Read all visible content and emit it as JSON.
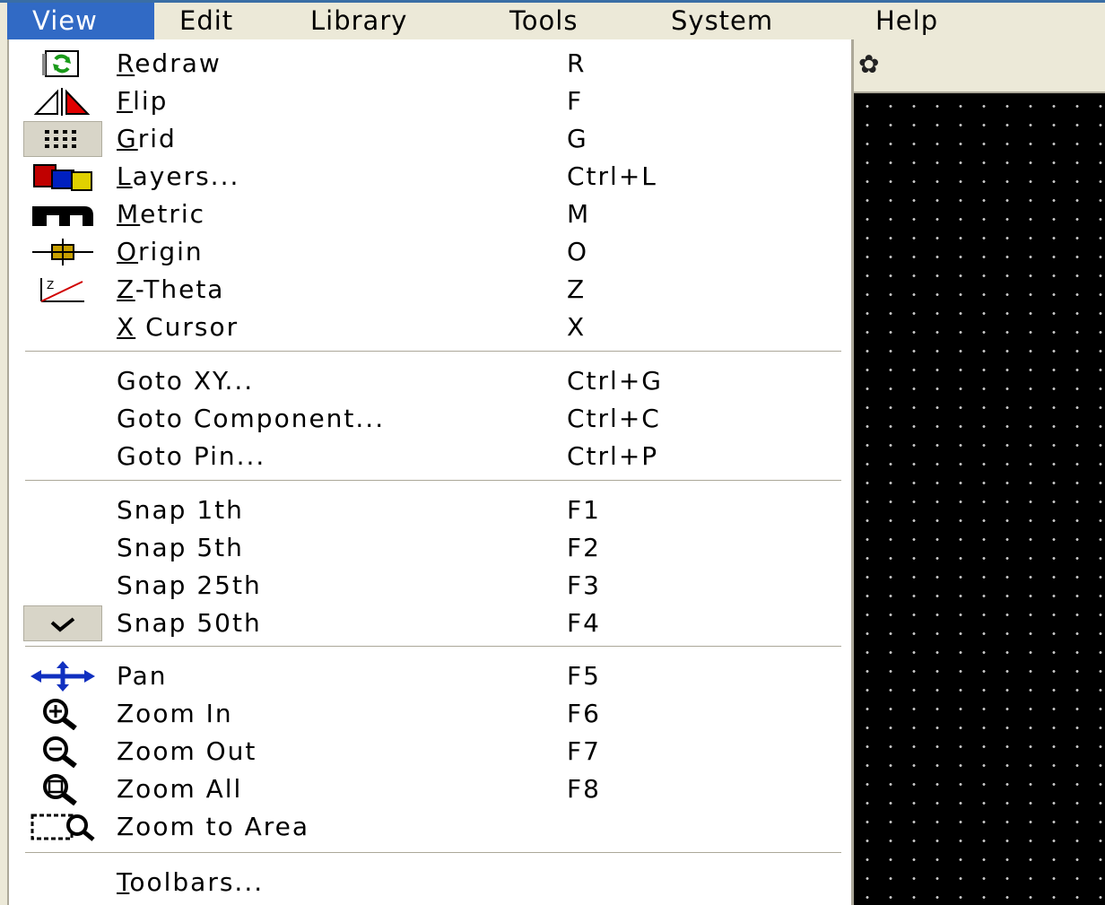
{
  "menubar": {
    "items": [
      {
        "label": "View",
        "active": true
      },
      {
        "label": "Edit"
      },
      {
        "label": "Library"
      },
      {
        "label": "Tools"
      },
      {
        "label": "System"
      },
      {
        "label": "Help"
      }
    ]
  },
  "view_menu": {
    "items": [
      {
        "label": "Redraw",
        "accel": "R",
        "shortcut": "R",
        "icon": "redraw-icon"
      },
      {
        "label": "Flip",
        "accel": "F",
        "shortcut": "F",
        "icon": "flip-icon"
      },
      {
        "label": "Grid",
        "accel": "G",
        "shortcut": "G",
        "icon": "grid-icon",
        "checked": true
      },
      {
        "label": "Layers...",
        "accel": "L",
        "shortcut": "Ctrl+L",
        "icon": "layers-icon"
      },
      {
        "label": "Metric",
        "accel": "M",
        "shortcut": "M",
        "icon": "metric-icon"
      },
      {
        "label": "Origin",
        "accel": "O",
        "shortcut": "O",
        "icon": "origin-icon"
      },
      {
        "label": "Z-Theta",
        "accel": "Z",
        "shortcut": "Z",
        "icon": "z-theta-icon"
      },
      {
        "label": "X Cursor",
        "accel": "X",
        "shortcut": "X"
      },
      {
        "label": "Goto XY...",
        "shortcut": "Ctrl+G"
      },
      {
        "label": "Goto Component...",
        "shortcut": "Ctrl+C"
      },
      {
        "label": "Goto Pin...",
        "shortcut": "Ctrl+P"
      },
      {
        "label": "Snap 1th",
        "shortcut": "F1"
      },
      {
        "label": "Snap 5th",
        "shortcut": "F2"
      },
      {
        "label": "Snap 25th",
        "shortcut": "F3"
      },
      {
        "label": "Snap 50th",
        "shortcut": "F4",
        "icon": "checkmark-icon",
        "checked": true
      },
      {
        "label": "Pan",
        "shortcut": "F5",
        "icon": "pan-icon"
      },
      {
        "label": "Zoom In",
        "shortcut": "F6",
        "icon": "zoom-in-icon"
      },
      {
        "label": "Zoom Out",
        "shortcut": "F7",
        "icon": "zoom-out-icon"
      },
      {
        "label": "Zoom All",
        "shortcut": "F8",
        "icon": "zoom-all-icon"
      },
      {
        "label": "Zoom to Area",
        "shortcut": "",
        "icon": "zoom-to-area-icon"
      },
      {
        "label": "Toolbars...",
        "accel": "T",
        "shortcut": ""
      }
    ]
  },
  "colors": {
    "menu_bar_bg": "#ece9d8",
    "active_menu_bg": "#316ac5",
    "canvas_bg": "#000000"
  }
}
